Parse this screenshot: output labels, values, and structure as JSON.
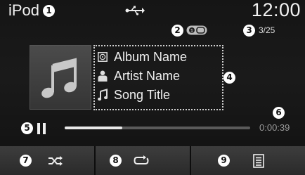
{
  "status": {
    "source": "iPod",
    "time": "12:00",
    "usb_icon": "usb-icon",
    "repeat_icon": "repeat-mode-icon",
    "track_count": "3/25"
  },
  "callouts": {
    "source_label": "1",
    "repeat_mode": "2",
    "track_count": "3",
    "track_info": "4",
    "play_pause": "5",
    "elapsed_time": "6",
    "shuffle": "7",
    "repeat": "8",
    "list": "9"
  },
  "track": {
    "album": "Album Name",
    "artist": "Artist Name",
    "song": "Song Title",
    "album_icon": "album-icon",
    "artist_icon": "artist-icon",
    "song_icon": "song-icon"
  },
  "playback": {
    "state_icon": "pause-icon",
    "progress_percent": 31,
    "elapsed": "0:00:39"
  },
  "buttons": [
    {
      "name": "shuffle-button",
      "icon": "shuffle-icon"
    },
    {
      "name": "repeat-button",
      "icon": "repeat-icon"
    },
    {
      "name": "list-button",
      "icon": "list-icon"
    }
  ],
  "colors": {
    "background": "#161616",
    "text": "#f0f0f0",
    "progress_fill": "#e8e8e8",
    "progress_track": "#5a5a5a",
    "elapsed_text": "#9a9a9a"
  }
}
